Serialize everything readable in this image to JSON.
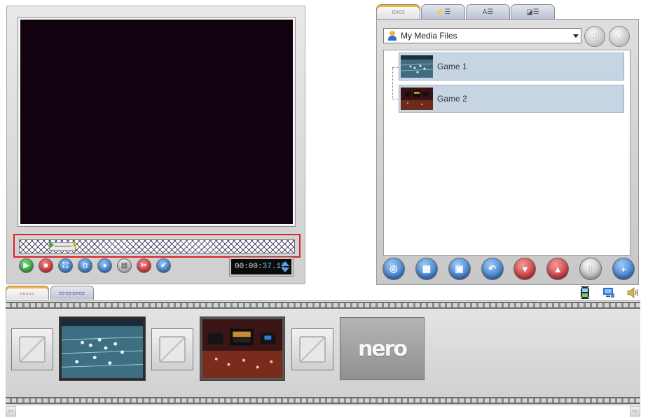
{
  "preview": {
    "timecode": {
      "main": "00:00:",
      "sub": "37.17"
    },
    "transport": [
      {
        "name": "play-button",
        "icon": "play-icon",
        "glyph": "▶",
        "color": "green"
      },
      {
        "name": "stop-button",
        "icon": "stop-icon",
        "glyph": "■",
        "color": "red"
      },
      {
        "name": "fullscreen-button",
        "icon": "fullscreen-icon",
        "glyph": "⛶",
        "color": "blue"
      },
      {
        "name": "snapshot-button",
        "icon": "camera-icon",
        "glyph": "◘",
        "color": "blue"
      },
      {
        "name": "record-audio-button",
        "icon": "microphone-icon",
        "glyph": "●",
        "color": "blue"
      },
      {
        "name": "film-button",
        "icon": "film-icon",
        "glyph": "▤",
        "color": "grey"
      },
      {
        "name": "cut-button",
        "icon": "scissors-icon",
        "glyph": "✂",
        "color": "red"
      },
      {
        "name": "confirm-button",
        "icon": "check-icon",
        "glyph": "✔",
        "color": "blue"
      }
    ]
  },
  "media": {
    "tabs": [
      {
        "name": "tab-media",
        "icon": "film-list-icon",
        "glyph": "▭▭",
        "active": true
      },
      {
        "name": "tab-effects",
        "icon": "effects-list-icon",
        "glyph": "⚡☰",
        "active": false
      },
      {
        "name": "tab-text",
        "icon": "text-list-icon",
        "glyph": "A☰",
        "active": false
      },
      {
        "name": "tab-transitions",
        "icon": "transition-list-icon",
        "glyph": "◪☰",
        "active": false
      }
    ],
    "source": "My Media Files",
    "source_buttons": [
      {
        "name": "rename-button",
        "glyph": "A|"
      },
      {
        "name": "import-button",
        "glyph": "▼"
      }
    ],
    "items": [
      {
        "name": "Game 1",
        "thumb": "field-thumb"
      },
      {
        "name": "Game 2",
        "thumb": "stadium-thumb"
      }
    ],
    "actions": [
      {
        "name": "search-media-button",
        "icon": "magnifier-icon",
        "glyph": "◎",
        "color": "blue"
      },
      {
        "name": "capture-video-button",
        "icon": "film-capture-icon",
        "glyph": "▦",
        "color": "blue"
      },
      {
        "name": "import-device-button",
        "icon": "device-icon",
        "glyph": "▣",
        "color": "blue"
      },
      {
        "name": "undo-button",
        "icon": "undo-icon",
        "glyph": "↶",
        "color": "blue"
      },
      {
        "name": "delete-button",
        "icon": "delete-icon",
        "glyph": "▼",
        "color": "red"
      },
      {
        "name": "remove-button",
        "icon": "remove-icon",
        "glyph": "▲",
        "color": "red"
      },
      {
        "name": "info-button",
        "icon": "info-icon",
        "glyph": "!",
        "color": "grey"
      },
      {
        "name": "add-button",
        "icon": "plus-icon",
        "glyph": "+",
        "color": "blue"
      }
    ]
  },
  "storyboard": {
    "tabs": [
      {
        "name": "tab-storyboard",
        "glyph": "▫▫▫▫▫",
        "active": true
      },
      {
        "name": "tab-timeline",
        "glyph": "▭▭▭▭",
        "active": false
      }
    ],
    "logo_text": "nero",
    "sequence": [
      "transition",
      "clip-field",
      "transition",
      "clip-stadium",
      "transition",
      "nero"
    ]
  },
  "colors": {
    "accent_tab": "#f2b53b",
    "highlight_border": "#d9232a",
    "video_bg": "#12010f"
  }
}
